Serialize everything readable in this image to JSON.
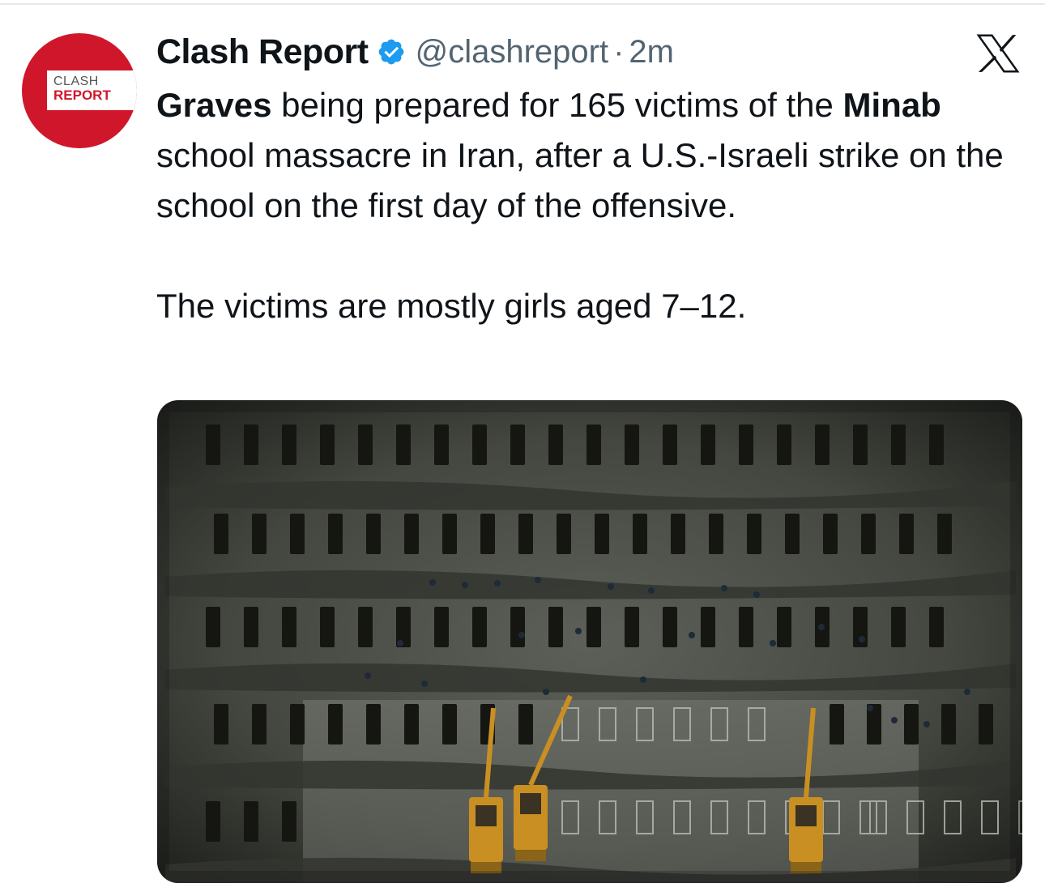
{
  "tweet": {
    "author_name": "Clash Report",
    "handle": "@clashreport",
    "separator": "·",
    "time": "2m",
    "avatar_text_top": "CLASH",
    "avatar_text_bottom": "REPORT",
    "text_p1_b1": "Graves",
    "text_p1_t1": " being prepared for 165 victims of the ",
    "text_p1_b2": "Minab",
    "text_p1_t2": " school massacre in Iran, after a U.S.-Israeli strike on the school on the first day of the offensive.",
    "text_p2": "The victims are mostly girls aged 7–12.",
    "media_alt_icon": "photo"
  },
  "colors": {
    "brand_red": "#d0162b",
    "verified_blue": "#1d9bf0",
    "secondary_text": "#536471"
  }
}
